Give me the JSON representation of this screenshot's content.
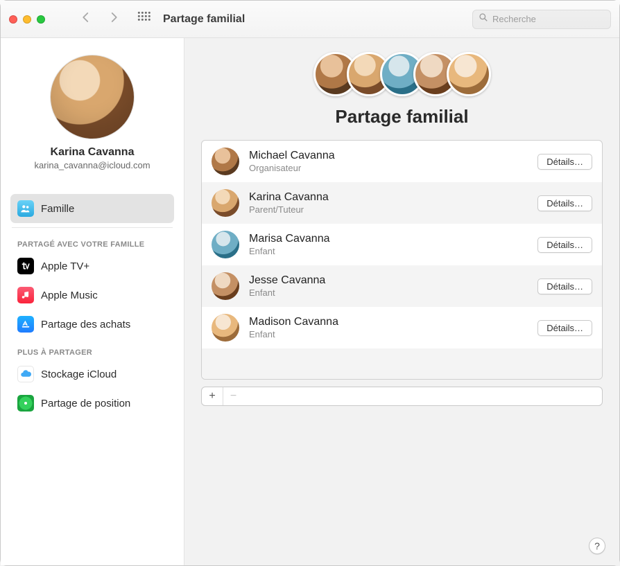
{
  "titlebar": {
    "title": "Partage familial",
    "search_placeholder": "Recherche"
  },
  "profile": {
    "name": "Karina Cavanna",
    "email": "karina_cavanna@icloud.com"
  },
  "sidebar": {
    "family_label": "Famille",
    "section_shared": "Partagé avec votre famille",
    "section_more": "Plus à partager",
    "items_shared": [
      {
        "label": "Apple TV+"
      },
      {
        "label": "Apple Music"
      },
      {
        "label": "Partage des achats"
      }
    ],
    "items_more": [
      {
        "label": "Stockage iCloud"
      },
      {
        "label": "Partage de position"
      }
    ]
  },
  "hero": {
    "title": "Partage familial"
  },
  "members": [
    {
      "name": "Michael Cavanna",
      "role": "Organisateur",
      "details": "Détails…",
      "avatar_class": "av-1"
    },
    {
      "name": "Karina Cavanna",
      "role": "Parent/Tuteur",
      "details": "Détails…",
      "avatar_class": "av-2"
    },
    {
      "name": "Marisa Cavanna",
      "role": "Enfant",
      "details": "Détails…",
      "avatar_class": "av-3"
    },
    {
      "name": "Jesse Cavanna",
      "role": "Enfant",
      "details": "Détails…",
      "avatar_class": "av-4"
    },
    {
      "name": "Madison Cavanna",
      "role": "Enfant",
      "details": "Détails…",
      "avatar_class": "av-5"
    }
  ],
  "controls": {
    "add": "+",
    "remove": "−",
    "help": "?"
  }
}
